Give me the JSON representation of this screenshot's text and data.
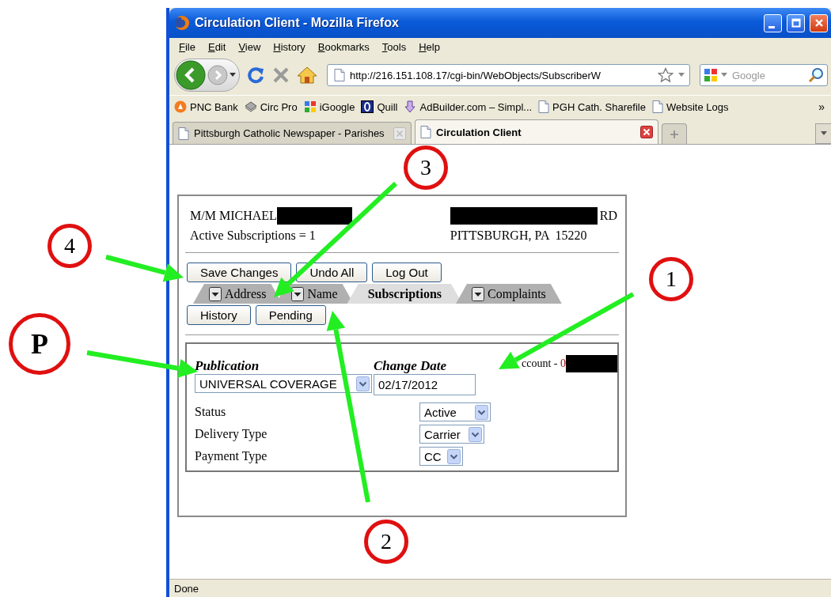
{
  "window": {
    "title": "Circulation Client - Mozilla Firefox"
  },
  "menu_bar": [
    "File",
    "Edit",
    "View",
    "History",
    "Bookmarks",
    "Tools",
    "Help"
  ],
  "url_bar": {
    "value": "http://216.151.108.17/cgi-bin/WebObjects/SubscriberW"
  },
  "search": {
    "placeholder": "Google"
  },
  "bookmarks": [
    {
      "label": "PNC Bank",
      "kind": "pnc"
    },
    {
      "label": "Circ Pro",
      "kind": "circ"
    },
    {
      "label": "iGoogle",
      "kind": "igoogle"
    },
    {
      "label": "Quill",
      "kind": "quill"
    },
    {
      "label": "AdBuilder.com – Simpl...",
      "kind": "adbuilder"
    },
    {
      "label": "PGH Cath. Sharefile",
      "kind": "page"
    },
    {
      "label": "Website Logs",
      "kind": "page"
    }
  ],
  "bookmarks_more": "»",
  "browser_tabs": [
    {
      "label": "Pittsburgh Catholic Newspaper - Parishes",
      "selected": false
    },
    {
      "label": "Circulation Client",
      "selected": true
    }
  ],
  "page": {
    "subscriber_name": "M/M MICHAEL",
    "address_suffix": "RD",
    "active_subscriptions": "Active Subscriptions = 1",
    "city_line": "PITTSBURGH, PA  15220",
    "action_buttons": [
      "Save Changes",
      "Undo All",
      "Log Out"
    ],
    "tabs": [
      {
        "label": "Address",
        "selected": false,
        "menu": true
      },
      {
        "label": "Name",
        "selected": false,
        "menu": true
      },
      {
        "label": "Subscriptions",
        "selected": true,
        "menu": false
      },
      {
        "label": "Complaints",
        "selected": false,
        "menu": true
      }
    ],
    "sub_buttons": [
      "History",
      "Pending"
    ],
    "publication": {
      "label": "Publication",
      "value": "UNIVERSAL COVERAGE"
    },
    "change_date": {
      "label": "Change Date",
      "value": "02/17/2012"
    },
    "account": {
      "label": "ccount - ",
      "number": "0"
    },
    "fields": [
      {
        "label": "Status",
        "value": "Active"
      },
      {
        "label": "Delivery Type",
        "value": "Carrier"
      },
      {
        "label": "Payment Type",
        "value": "CC"
      }
    ]
  },
  "status_bar": {
    "text": "Done"
  },
  "annotations": [
    {
      "label": "3"
    },
    {
      "label": "4"
    },
    {
      "label": "1"
    },
    {
      "label": "P"
    },
    {
      "label": "2"
    }
  ]
}
